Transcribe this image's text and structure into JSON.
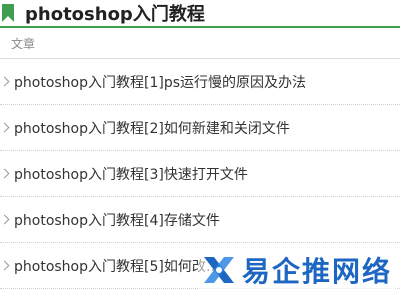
{
  "header": {
    "title": "photoshop入门教程",
    "icon": "bookmark-icon",
    "accent_color": "#3f9e4f"
  },
  "section": {
    "label": "文章"
  },
  "articles": [
    {
      "label": "photoshop入门教程[1]ps运行慢的原因及办法"
    },
    {
      "label": "photoshop入门教程[2]如何新建和关闭文件"
    },
    {
      "label": "photoshop入门教程[3]快速打开文件"
    },
    {
      "label": "photoshop入门教程[4]存储文件"
    },
    {
      "label": "photoshop入门教程[5]如何改…"
    }
  ],
  "watermark": {
    "text": "易企推网络",
    "icon": "x-logo-icon",
    "color": "#1d67c2"
  }
}
